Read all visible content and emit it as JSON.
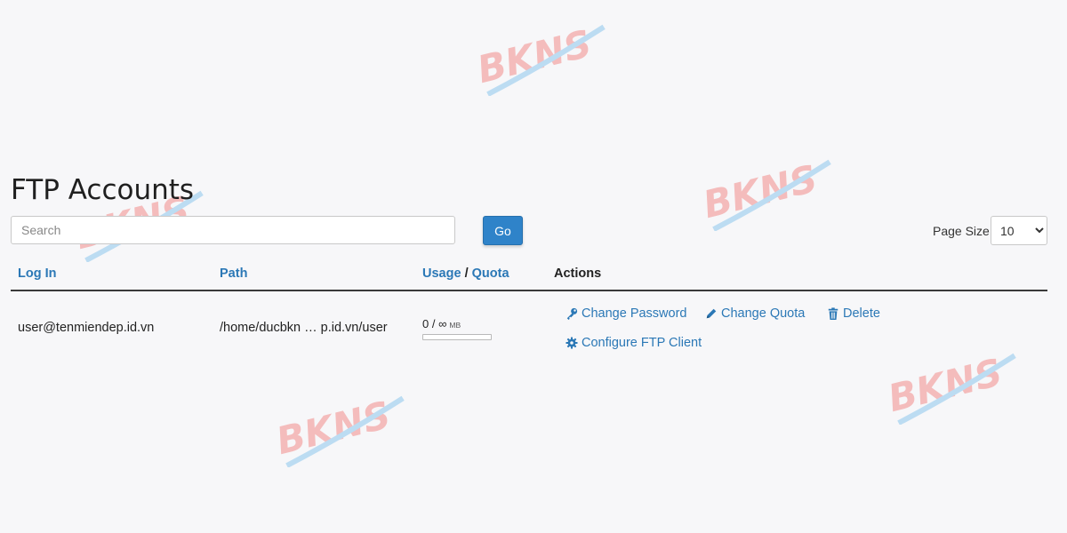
{
  "page_title": "FTP Accounts",
  "watermark_text": "BKNS",
  "search": {
    "placeholder": "Search"
  },
  "go_label": "Go",
  "page_size": {
    "label": "Page Size",
    "value": "10",
    "options": [
      "10"
    ]
  },
  "table": {
    "headers": {
      "login": "Log In",
      "path": "Path",
      "usage": "Usage",
      "separator": "/",
      "quota": "Quota",
      "actions": "Actions"
    },
    "rows": [
      {
        "login": "user@tenmiendep.id.vn",
        "path": "/home/ducbkn … p.id.vn/user",
        "usage_value": "0",
        "usage_separator": "/",
        "quota_value": "∞",
        "usage_unit": "MB",
        "usage_fraction": 0,
        "actions": {
          "change_password": "Change Password",
          "change_quota": "Change Quota",
          "delete": "Delete",
          "configure": "Configure FTP Client"
        }
      }
    ]
  },
  "colors": {
    "link": "#2b78b6",
    "primary_button": "#2f83c9",
    "watermark_red": "#f4bcbc",
    "watermark_blue": "#bcdcf2"
  },
  "icons": {
    "change_password": "key-icon",
    "change_quota": "pencil-icon",
    "delete": "trash-icon",
    "configure": "gear-icon"
  }
}
